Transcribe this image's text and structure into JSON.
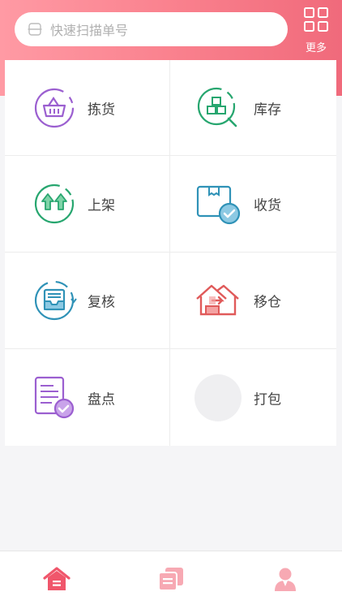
{
  "search": {
    "placeholder": "快速扫描单号"
  },
  "header": {
    "more_label": "更多"
  },
  "menu": [
    {
      "label": "拣货",
      "icon": "basket-icon"
    },
    {
      "label": "库存",
      "icon": "inventory-search-icon"
    },
    {
      "label": "上架",
      "icon": "shelve-up-icon"
    },
    {
      "label": "收货",
      "icon": "receive-box-icon"
    },
    {
      "label": "复核",
      "icon": "review-tray-icon"
    },
    {
      "label": "移仓",
      "icon": "move-warehouse-icon"
    },
    {
      "label": "盘点",
      "icon": "stocktake-icon"
    },
    {
      "label": "打包",
      "icon": "pack-placeholder-icon"
    }
  ],
  "colors": {
    "accent": "#f46b7c",
    "purple": "#9b5fd0",
    "green": "#27a66f",
    "teal": "#2f92b7",
    "red": "#e05a5a"
  },
  "tabbar": {
    "items": [
      "home-icon",
      "documents-icon",
      "user-icon"
    ]
  }
}
